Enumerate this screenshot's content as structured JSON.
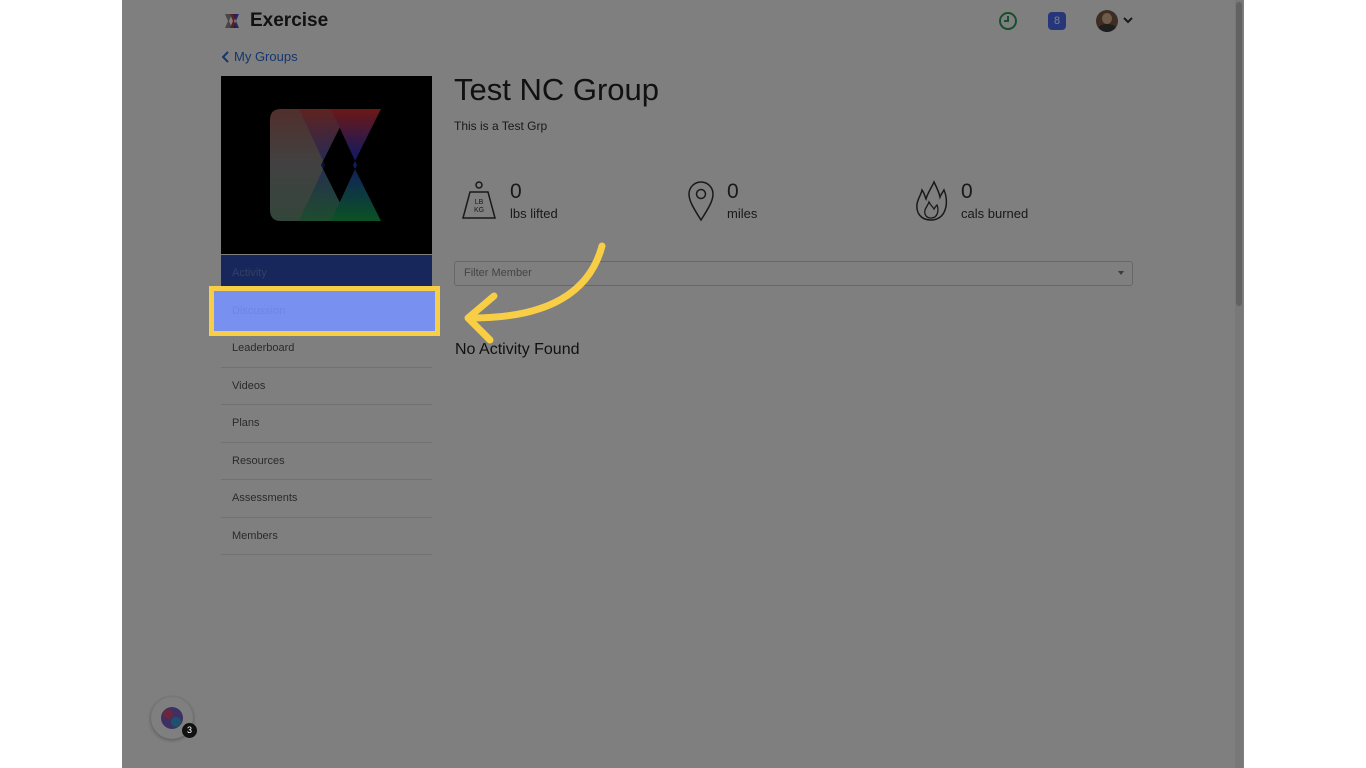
{
  "header": {
    "brand_name": "Exercise",
    "notification_count": "8"
  },
  "back_link": "My Groups",
  "group": {
    "title": "Test NC Group",
    "description": "This is a Test Grp"
  },
  "stats": [
    {
      "value": "0",
      "label": "lbs lifted",
      "icon": "weight-icon"
    },
    {
      "value": "0",
      "label": "miles",
      "icon": "location-pin-icon"
    },
    {
      "value": "0",
      "label": "cals burned",
      "icon": "flame-icon"
    }
  ],
  "weight_icon_text": {
    "line1": "LB",
    "line2": "KG"
  },
  "nav": {
    "items": [
      "Activity",
      "Discussion",
      "Leaderboard",
      "Videos",
      "Plans",
      "Resources",
      "Assessments",
      "Members"
    ]
  },
  "filter": {
    "placeholder": "Filter Member"
  },
  "empty_message": "No Activity Found",
  "launcher": {
    "badge": "3"
  },
  "colors": {
    "highlight": "#f7ce45",
    "active_nav": "#2f4eb7",
    "link": "#2b6cd8"
  }
}
